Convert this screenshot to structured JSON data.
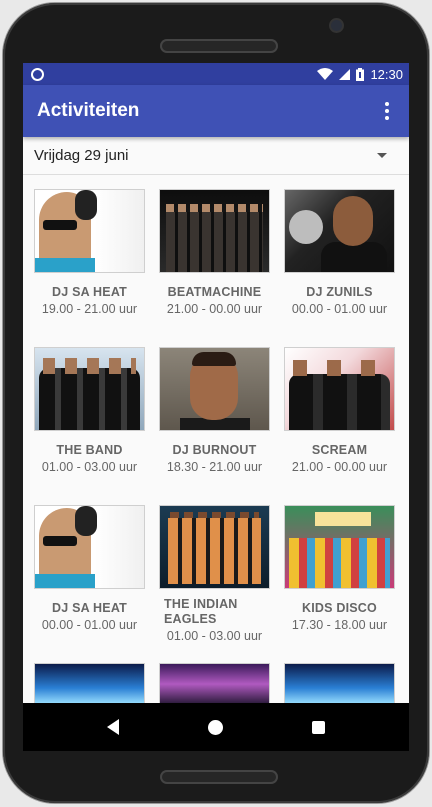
{
  "status_bar": {
    "time": "12:30"
  },
  "app_bar": {
    "title": "Activiteiten"
  },
  "date_selector": {
    "value": "Vrijdag 29 juni"
  },
  "activities": [
    {
      "name": "DJ SA HEAT",
      "time": "19.00 - 21.00 uur",
      "image": "dj-sa-heat"
    },
    {
      "name": "BEATMACHINE",
      "time": "21.00 - 00.00 uur",
      "image": "beatmachine"
    },
    {
      "name": "DJ ZUNILS",
      "time": "00.00 - 01.00 uur",
      "image": "dj-zunils"
    },
    {
      "name": "THE BAND",
      "time": "01.00 - 03.00 uur",
      "image": "the-band"
    },
    {
      "name": "DJ BURNOUT",
      "time": "18.30 - 21.00 uur",
      "image": "dj-burnout"
    },
    {
      "name": "SCREAM",
      "time": "21.00 - 00.00 uur",
      "image": "scream"
    },
    {
      "name": "DJ SA HEAT",
      "time": "00.00 - 01.00 uur",
      "image": "dj-sa-heat"
    },
    {
      "name": "THE INDIAN EAGLES",
      "time": "01.00 - 03.00 uur",
      "image": "the-indian-eagles"
    },
    {
      "name": "KIDS DISCO",
      "time": "17.30 - 18.00 uur",
      "image": "kids-disco"
    }
  ],
  "icons": {
    "notification": "notification-circle-icon",
    "wifi": "wifi-icon",
    "signal": "cell-signal-icon",
    "battery": "battery-icon",
    "overflow": "more-vert-icon",
    "dropdown": "arrow-drop-down-icon",
    "back": "nav-back-icon",
    "home": "nav-home-icon",
    "recents": "nav-recents-icon"
  },
  "colors": {
    "status_bar": "#303f9f",
    "app_bar": "#3f51b5",
    "background": "#fafafa",
    "text_secondary": "#666666"
  }
}
